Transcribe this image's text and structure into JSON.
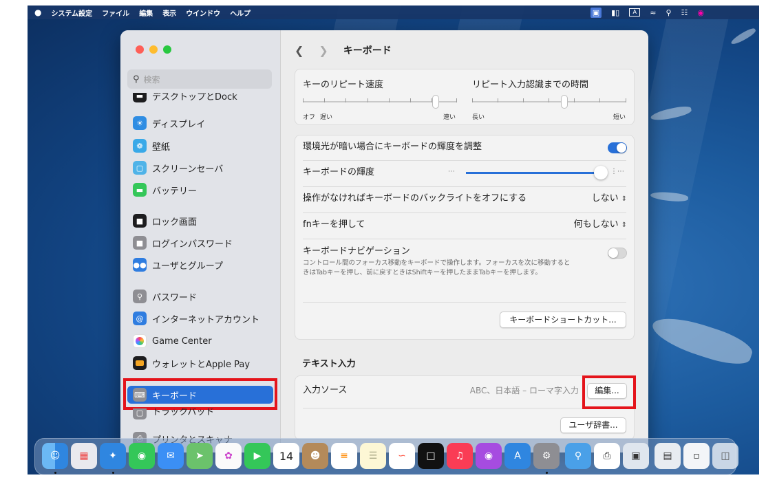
{
  "menubar": {
    "apple": "",
    "items": [
      "システム設定",
      "ファイル",
      "編集",
      "表示",
      "ウインドウ",
      "ヘルプ"
    ],
    "status_icons": [
      "display-icon",
      "battery-icon",
      "input-a-icon",
      "wifi-icon",
      "search-icon",
      "control-center-icon",
      "siri-icon"
    ],
    "input_label": "A"
  },
  "sidebar": {
    "search_placeholder": "検索",
    "items": [
      {
        "label": "デスクトップとDock",
        "icon": "dock-icon",
        "color": "#1d1d1f"
      },
      {
        "label": "ディスプレイ",
        "icon": "display-icon",
        "color": "#2f8de3"
      },
      {
        "label": "壁紙",
        "icon": "wallpaper-icon",
        "color": "#39a9e8"
      },
      {
        "label": "スクリーンセーバ",
        "icon": "screensaver-icon",
        "color": "#4fb3e8"
      },
      {
        "label": "バッテリー",
        "icon": "battery-icon",
        "color": "#34c759"
      },
      {
        "label": "ロック画面",
        "icon": "lock-screen-icon",
        "color": "#1d1d1f"
      },
      {
        "label": "ログインパスワード",
        "icon": "login-lock-icon",
        "color": "#8e8e93"
      },
      {
        "label": "ユーザとグループ",
        "icon": "users-icon",
        "color": "#2f7de0"
      },
      {
        "label": "パスワード",
        "icon": "key-icon",
        "color": "#8e8e93"
      },
      {
        "label": "インターネットアカウント",
        "icon": "at-icon",
        "color": "#2f7de0"
      },
      {
        "label": "Game Center",
        "icon": "game-center-icon",
        "color": "#ffffff"
      },
      {
        "label": "ウォレットとApple Pay",
        "icon": "wallet-icon",
        "color": "#1d1d1f"
      },
      {
        "label": "キーボード",
        "icon": "keyboard-icon",
        "color": "#8e8e93"
      },
      {
        "label": "トラックパッド",
        "icon": "trackpad-icon",
        "color": "#8e8e93"
      },
      {
        "label": "プリンタとスキャナ",
        "icon": "printer-icon",
        "color": "#8e8e93"
      }
    ]
  },
  "nav": {
    "title": "キーボード"
  },
  "repeat": {
    "rate_label": "キーのリピート速度",
    "rate_left": "オフ",
    "rate_left2": "遅い",
    "rate_right": "速い",
    "rate_value": 0.86,
    "delay_label": "リピート入力認識までの時間",
    "delay_left": "長い",
    "delay_right": "短い",
    "delay_value": 0.6
  },
  "brightness": {
    "auto_label": "環境光が暗い場合にキーボードの輝度を調整",
    "auto_on": true,
    "level_label": "キーボードの輝度",
    "level_value": 0.98,
    "backlight_label": "操作がなければキーボードのバックライトをオフにする",
    "backlight_value": "しない",
    "fn_label": "fnキーを押して",
    "fn_value": "何もしない",
    "nav_label": "キーボードナビゲーション",
    "nav_desc": "コントロール間のフォーカス移動をキーボードで操作します。フォーカスを次に移動するときはTabキーを押し、前に戻すときはShiftキーを押したままTabキーを押します。",
    "nav_on": false,
    "shortcuts_button": "キーボードショートカット..."
  },
  "text_input": {
    "section_title": "テキスト入力",
    "source_label": "入力ソース",
    "source_value": "ABC、日本語 – ローマ字入力",
    "edit_button": "編集...",
    "dictionary_button": "ユーザ辞書..."
  },
  "dock": {
    "icons": [
      "finder-icon",
      "launchpad-icon",
      "safari-icon",
      "messages-icon",
      "mail-icon",
      "maps-icon",
      "photos-icon",
      "facetime-icon",
      "calendar-icon",
      "contacts-icon",
      "reminders-icon",
      "notes-icon",
      "freeform-icon",
      "tv-icon",
      "music-icon",
      "podcasts-icon",
      "appstore-icon",
      "settings-icon",
      "preview-icon",
      "printer-queue-icon",
      "screenshot-icon",
      "downloads-icon",
      "document-icon",
      "trash-icon"
    ],
    "calendar_day": "14"
  },
  "colors": {
    "accent": "#2870d8",
    "highlight": "#e4141b"
  }
}
